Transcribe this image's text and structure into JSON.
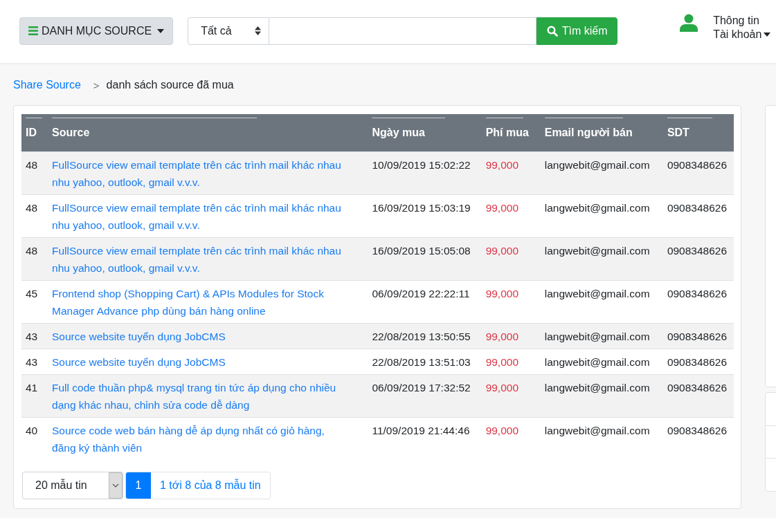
{
  "header": {
    "menu_button": "DANH MỤC SOURCE",
    "category_select": "Tất cả",
    "search_button": "Tìm kiếm",
    "account": [
      "Thông tin",
      "Tài khoản"
    ]
  },
  "breadcrumb": {
    "link": "Share Source",
    "separator": ">",
    "current": "danh sách source đã mua"
  },
  "table": {
    "columns": [
      "ID",
      "Source",
      "Ngày mua",
      "Phí mua",
      "Email người bán",
      "SDT"
    ],
    "rows": [
      {
        "id": "48",
        "source": "FullSource view email template trên các trình mail khác nhau nhu yahoo, outlook, gmail v.v.v.",
        "date": "10/09/2019 15:02:22",
        "price": "99,000",
        "email": "langwebit@gmail.com",
        "phone": "0908348626"
      },
      {
        "id": "48",
        "source": "FullSource view email template trên các trình mail khác nhau nhu yahoo, outlook, gmail v.v.v.",
        "date": "16/09/2019 15:03:19",
        "price": "99,000",
        "email": "langwebit@gmail.com",
        "phone": "0908348626"
      },
      {
        "id": "48",
        "source": "FullSource view email template trên các trình mail khác nhau nhu yahoo, outlook, gmail v.v.v.",
        "date": "16/09/2019 15:05:08",
        "price": "99,000",
        "email": "langwebit@gmail.com",
        "phone": "0908348626"
      },
      {
        "id": "45",
        "source": "Frontend shop (Shopping Cart) & APIs Modules for Stock Manager Advance php dùng bán hàng online",
        "date": "06/09/2019 22:22:11",
        "price": "99,000",
        "email": "langwebit@gmail.com",
        "phone": "0908348626"
      },
      {
        "id": "43",
        "source": "Source website tuyển dụng JobCMS",
        "date": "22/08/2019 13:50:55",
        "price": "99,000",
        "email": "langwebit@gmail.com",
        "phone": "0908348626"
      },
      {
        "id": "43",
        "source": "Source website tuyển dụng JobCMS",
        "date": "22/08/2019 13:51:03",
        "price": "99,000",
        "email": "langwebit@gmail.com",
        "phone": "0908348626"
      },
      {
        "id": "41",
        "source": "Full code thuần php& mysql trang tin tức áp dụng cho nhiều dạng khác nhau, chỉnh sửa code dễ dàng",
        "date": "06/09/2019 17:32:52",
        "price": "99,000",
        "email": "langwebit@gmail.com",
        "phone": "0908348626"
      },
      {
        "id": "40",
        "source": "Source code web bán hàng dễ áp dụng nhất có giỏ hàng, đăng ký thành viên",
        "date": "11/09/2019 21:44:46",
        "price": "99,000",
        "email": "langwebit@gmail.com",
        "phone": "0908348626"
      }
    ]
  },
  "pagination": {
    "page_size": "20 mẫu tin",
    "pages": [
      {
        "label": "1",
        "selected": true
      }
    ],
    "info": "1 tới 8 của 8 mẫu tin"
  }
}
